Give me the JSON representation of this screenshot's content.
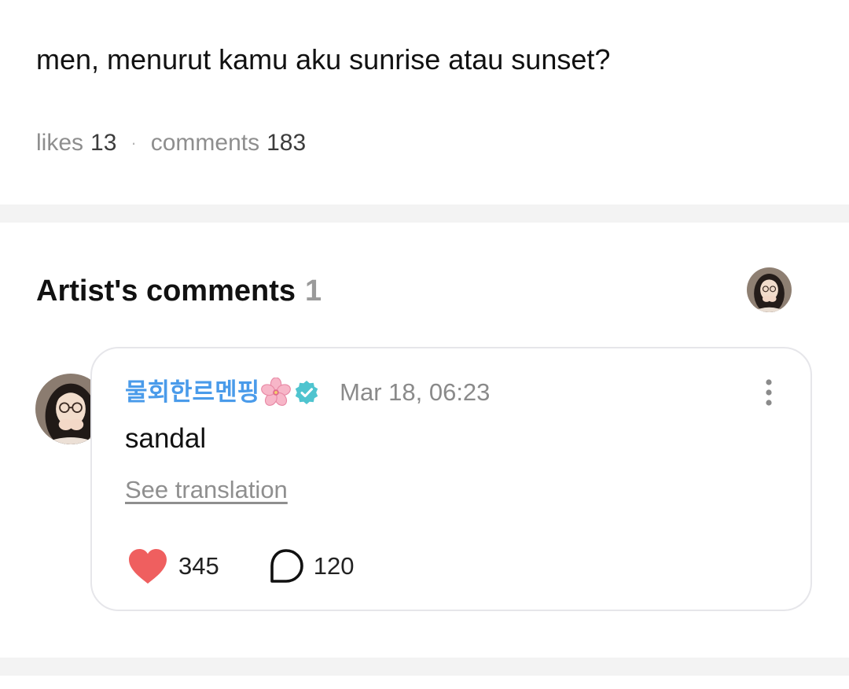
{
  "post": {
    "text": "men, menurut kamu aku sunrise atau sunset?",
    "likes_label": "likes",
    "likes_count": "13",
    "separator": "·",
    "comments_label": "comments",
    "comments_count": "183"
  },
  "artist_comments": {
    "title": "Artist's comments",
    "count": "1",
    "comment": {
      "author": "물회한르멘핑",
      "author_emoji_icon": "cherry-blossom-icon",
      "verified_icon": "verified-badge-icon",
      "date": "Mar 18, 06:23",
      "text": "sandal",
      "translate_label": "See translation",
      "like_count": "345",
      "reply_count": "120"
    }
  },
  "colors": {
    "author_name": "#4a9bea",
    "verified_badge": "#4fc4cf",
    "heart": "#ef5f5f",
    "muted_text": "#8e8e8e",
    "separator_bg": "#f3f3f3",
    "card_border": "#e6e6ea"
  }
}
